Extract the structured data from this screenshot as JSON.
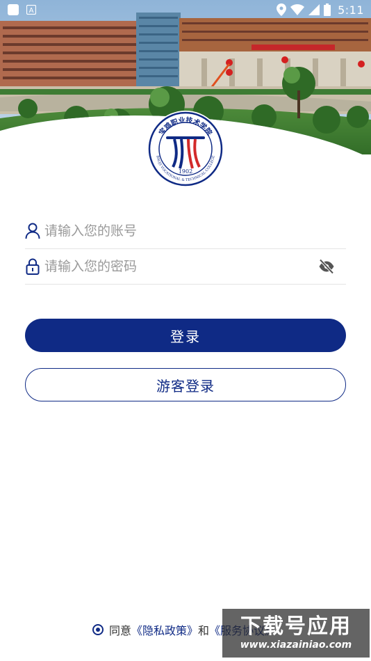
{
  "status_bar": {
    "time": "5:11",
    "left_icons": [
      "app-square-icon",
      "font-a-icon"
    ],
    "right_icons": [
      "location-pin-icon",
      "wifi-icon",
      "cellular-signal-icon",
      "battery-icon"
    ],
    "font_icon_glyph": "A"
  },
  "logo": {
    "year": "1902",
    "name": "宝鸡职业技术学院",
    "english": "BAOJI VOCATIONAL & TECHNICAL COLLEGE"
  },
  "form": {
    "account_placeholder": "请输入您的账号",
    "password_placeholder": "请输入您的密码",
    "account_icon": "user-icon",
    "password_icon": "lock-icon",
    "toggle_icon": "eye-off-icon"
  },
  "buttons": {
    "login": "登录",
    "guest_login": "游客登录"
  },
  "agreement": {
    "prefix": "同意",
    "privacy_link": "《隐私政策》",
    "conjunction": "和",
    "service_link": "《服务协议》"
  },
  "watermark": {
    "main": "下载号应用",
    "url": "www.xiazainiao.com"
  },
  "colors": {
    "primary": "#0f2a85",
    "placeholder": "#9a9a9a",
    "divider": "#e4e4e4",
    "logo_red": "#d22a2a"
  }
}
